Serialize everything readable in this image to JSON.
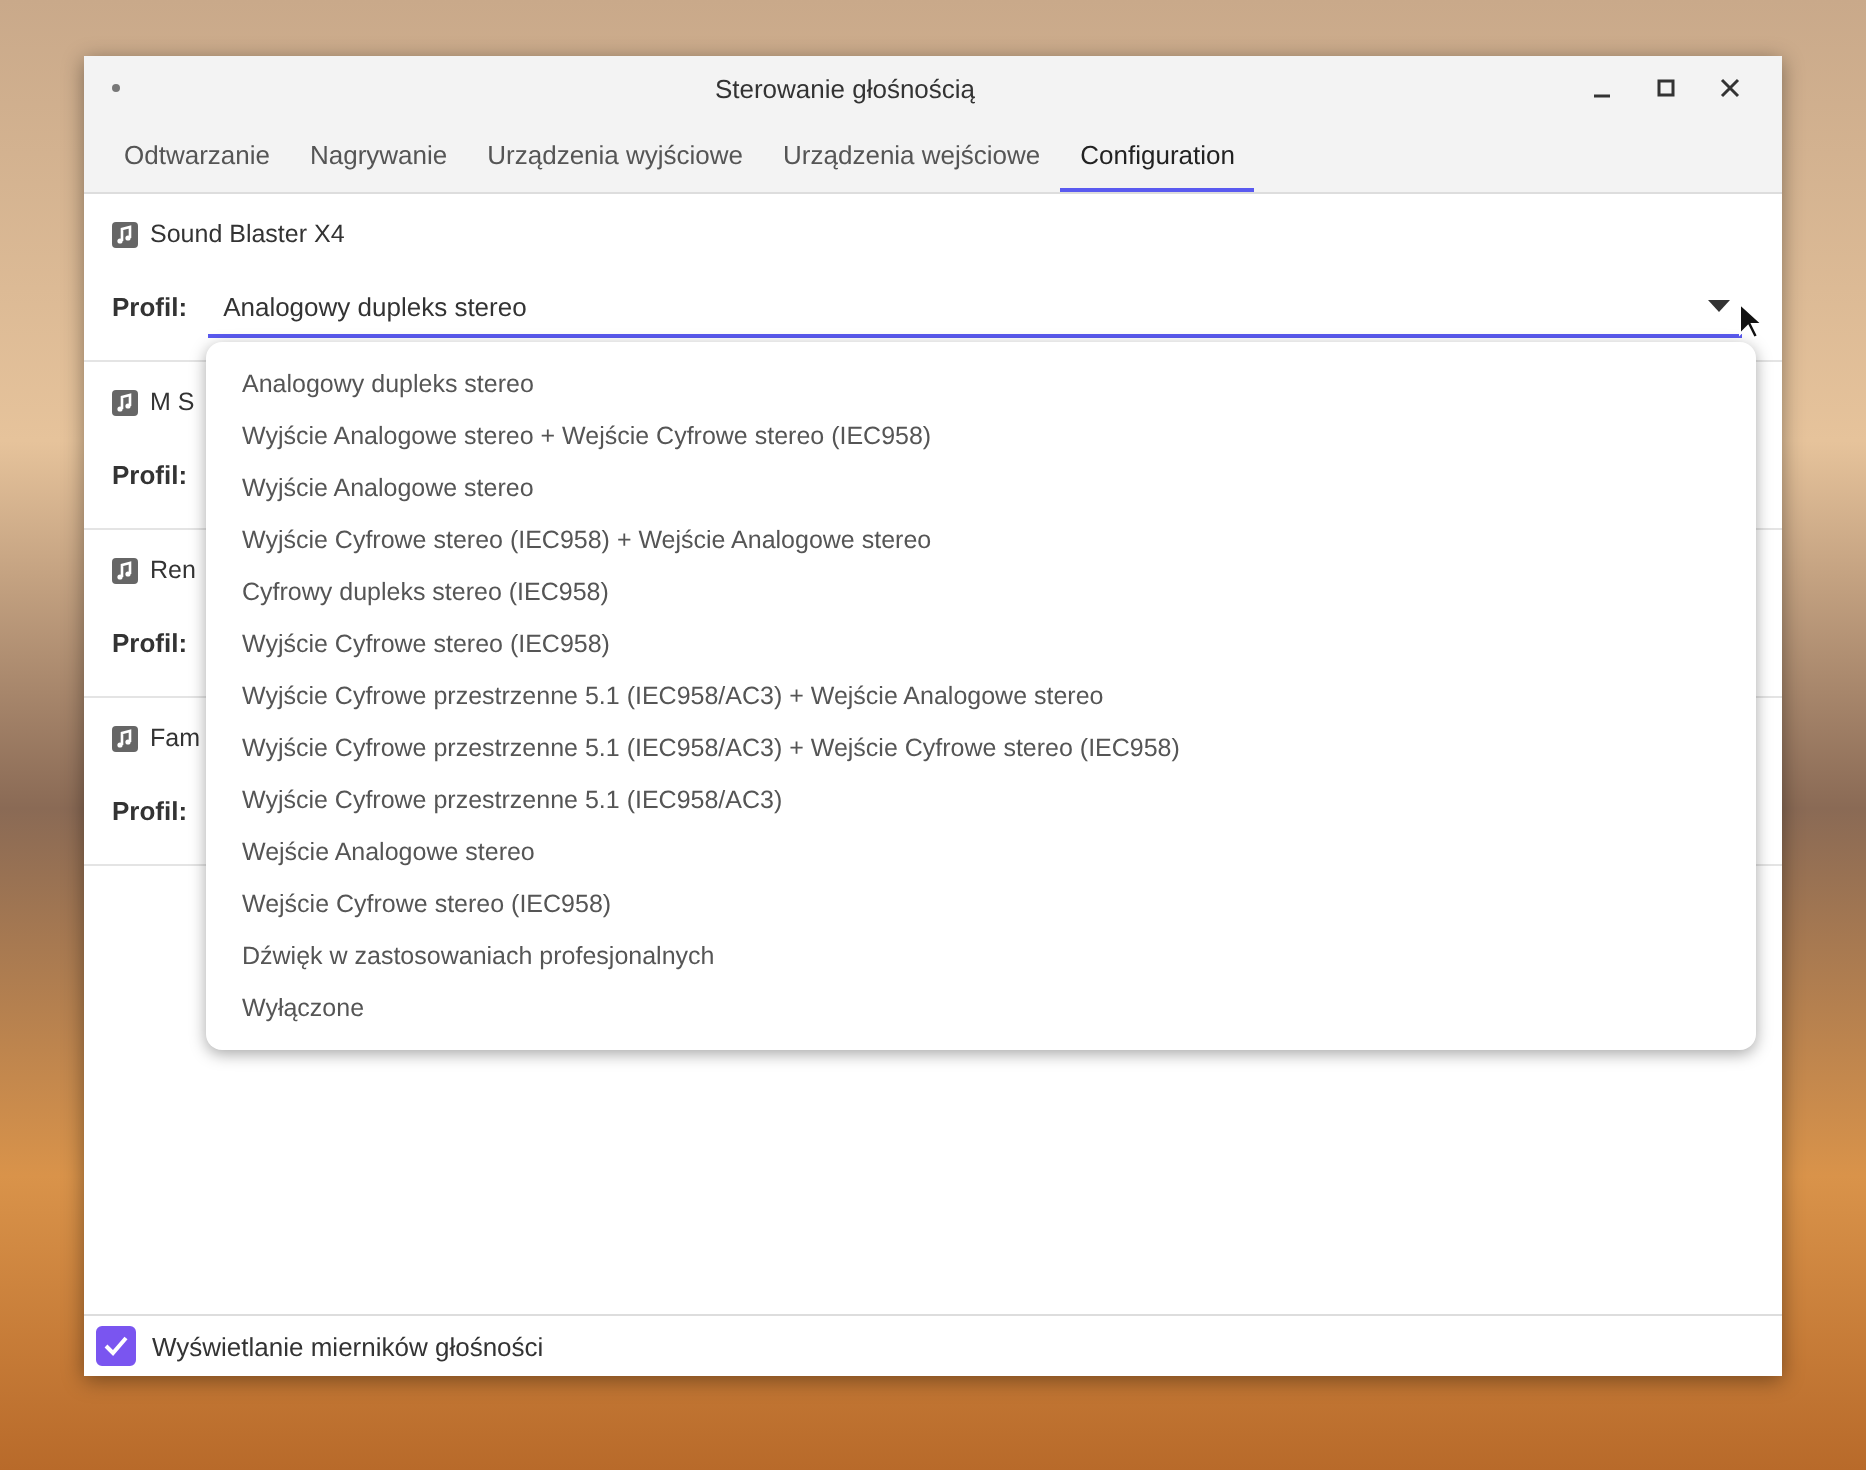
{
  "window": {
    "title": "Sterowanie głośnością"
  },
  "tabs": [
    {
      "label": "Odtwarzanie",
      "selected": false
    },
    {
      "label": "Nagrywanie",
      "selected": false
    },
    {
      "label": "Urządzenia wyjściowe",
      "selected": false
    },
    {
      "label": "Urządzenia wejściowe",
      "selected": false
    },
    {
      "label": "Configuration",
      "selected": true
    }
  ],
  "cards": [
    {
      "name": "Sound Blaster X4",
      "profile_label": "Profil:",
      "profile_value": "Analogowy dupleks stereo",
      "kind": "open"
    },
    {
      "name": "M S",
      "profile_label": "Profil:",
      "kind": "covered"
    },
    {
      "name": "Ren",
      "profile_label": "Profil:",
      "kind": "covered"
    },
    {
      "name": "Fam",
      "profile_label": "Profil:",
      "kind": "covered"
    }
  ],
  "popup": {
    "items": [
      "Analogowy dupleks stereo",
      "Wyjście Analogowe stereo + Wejście Cyfrowe stereo (IEC958)",
      "Wyjście Analogowe stereo",
      "Wyjście Cyfrowe stereo (IEC958) + Wejście Analogowe stereo",
      "Cyfrowy dupleks stereo (IEC958)",
      "Wyjście Cyfrowe stereo (IEC958)",
      "Wyjście Cyfrowe przestrzenne 5.1 (IEC958/AC3) + Wejście Analogowe stereo",
      "Wyjście Cyfrowe przestrzenne 5.1 (IEC958/AC3) + Wejście Cyfrowe stereo (IEC958)",
      "Wyjście Cyfrowe przestrzenne 5.1 (IEC958/AC3)",
      "Wejście Analogowe stereo",
      "Wejście Cyfrowe stereo (IEC958)",
      "Dźwięk w zastosowaniach profesjonalnych",
      "Wyłączone"
    ]
  },
  "footer": {
    "label": "Wyświetlanie mierników głośności",
    "checked": true
  }
}
